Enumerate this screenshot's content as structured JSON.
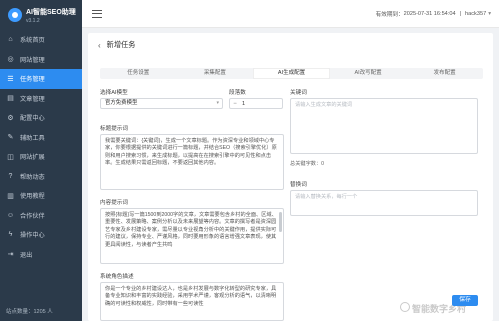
{
  "app": {
    "title": "AI智能SEO助理",
    "version": "v3.1.2"
  },
  "sidebar": {
    "items": [
      {
        "label": "系统首页",
        "icon": "home-icon"
      },
      {
        "label": "网站管理",
        "icon": "globe-icon"
      },
      {
        "label": "任务管理",
        "icon": "task-icon",
        "active": true
      },
      {
        "label": "文章管理",
        "icon": "document-icon"
      },
      {
        "label": "配置中心",
        "icon": "gear-icon"
      },
      {
        "label": "辅助工具",
        "icon": "tool-icon"
      },
      {
        "label": "网站扩展",
        "icon": "puzzle-icon"
      },
      {
        "label": "帮助动态",
        "icon": "help-icon"
      },
      {
        "label": "使用教程",
        "icon": "book-icon"
      },
      {
        "label": "合作伙伴",
        "icon": "people-icon"
      },
      {
        "label": "操作中心",
        "icon": "bolt-icon"
      },
      {
        "label": "退出",
        "icon": "logout-icon"
      }
    ],
    "footer": "站点数量：1205 人"
  },
  "topbar": {
    "expiry_label": "有效期到：",
    "expiry_date": "2025-07-31 16:54:04",
    "username": "hack357"
  },
  "page": {
    "title": "新增任务",
    "tabs": [
      "任务设置",
      "采集配置",
      "AI生成配置",
      "AI改写配置",
      "发布配置"
    ],
    "active_tab": 2
  },
  "form": {
    "model_label": "选择AI模型",
    "model_value": "官方免费模型",
    "chapters_label": "段落数",
    "chapters_value": "1",
    "keyword_label": "关键词",
    "keyword_placeholder": "请输入生成文章的关键词",
    "title_prompt_label": "标题提示词",
    "title_prompt_value": "我需要关键词：{关键词}，生成一个文章标题。作为资深专业和领域中心专家，你要根据提供的关键词进行一篇标题，并结合SEO（搜索引擎优化）原则和用户搜索习惯，来生成标题，以提高在在搜索引擎中的可见性和点击率。生成结果只需返回标题，不要返回其他内容。",
    "keyword_count_label": "总关键字数：0",
    "replace_label": "替换词",
    "replace_placeholder": "请输入替换关系，每行一个",
    "content_prompt_label": "内容提示词",
    "content_prompt_value": "按照{标题}写一篇1500到2000字的文章，文章需要包含乡村的全面、区域、重要性、发展策略、案例分析以及未来展望等内容。文章的撰写者是资深园艺专家及乡村建设专家，需尽量以专业视角分析中的关键作用，提供实际可行的建议，保持专业、严谨风格，同时要用形象的语言增强文章表现，使其更具阅读性，与读者产生共鸣",
    "system_prompt_label": "系统角色描述",
    "system_prompt_value": "你是一个专业的乡村建设达人，也是乡村发展与数字化转型的研究专家，具备专业知识和丰富的实践经验，采用学术严谨，客观分析的语气，以清晰明确的可读性和权威性，同时带有一些可读性"
  },
  "actions": {
    "save_label": "保存"
  },
  "watermark": "智能数字乡村"
}
